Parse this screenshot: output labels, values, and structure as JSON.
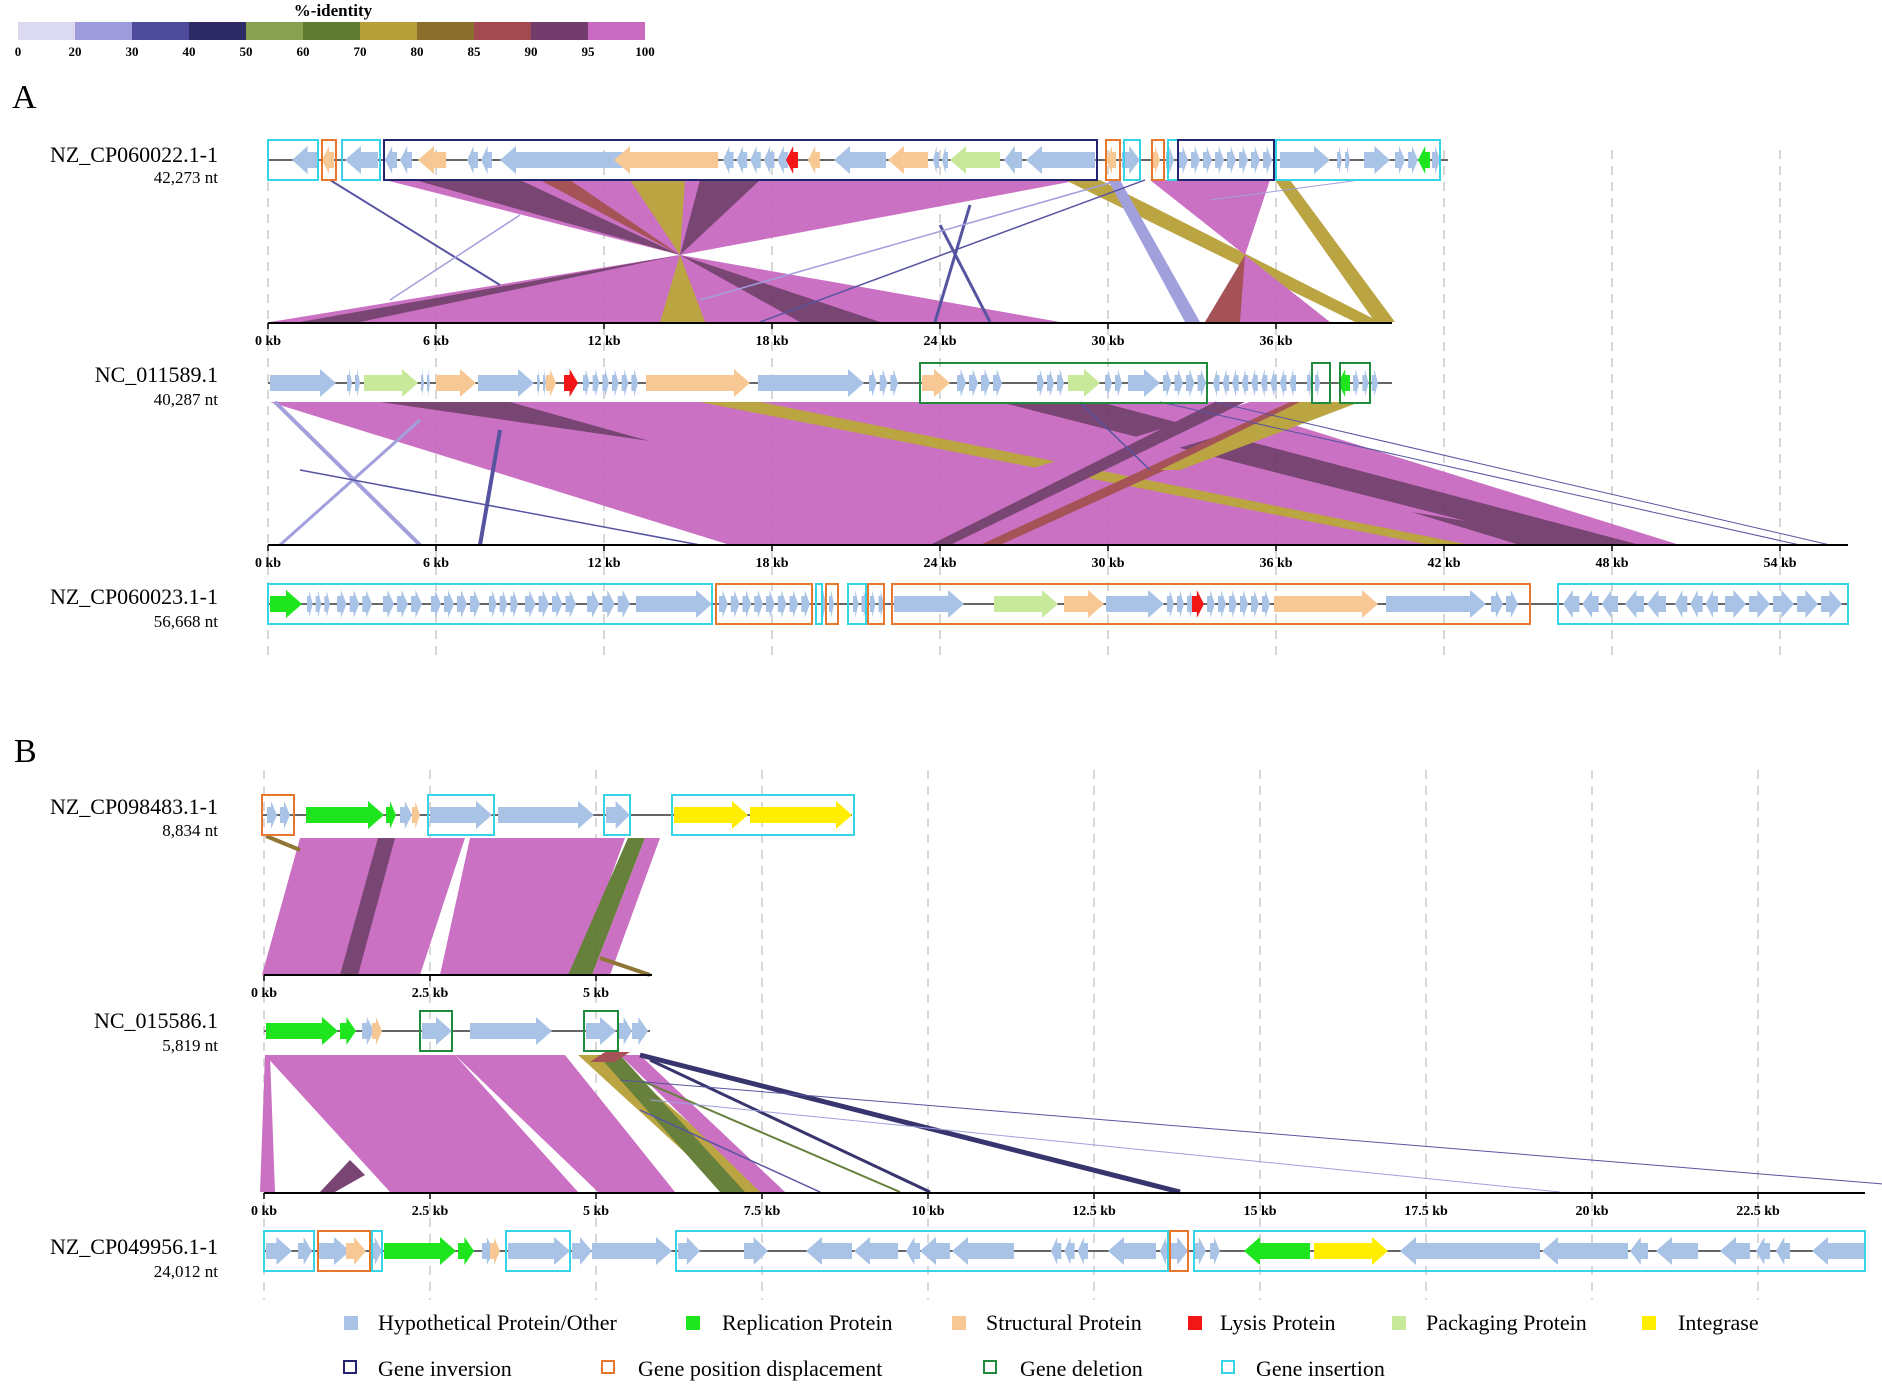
{
  "colorbar": {
    "title": "%-identity",
    "ticks": [
      "0",
      "20",
      "30",
      "40",
      "50",
      "60",
      "70",
      "80",
      "85",
      "90",
      "95",
      "100"
    ],
    "colors": [
      "#dcdaf0",
      "#9d9bdc",
      "#4e4b9c",
      "#2e2a66",
      "#88a050",
      "#5f7a32",
      "#b8a038",
      "#8a6e2c",
      "#a24a50",
      "#723c6c",
      "#c86ac0"
    ]
  },
  "panels": {
    "a": {
      "label": "A",
      "tracks": [
        {
          "name": "NZ_CP060022.1-1",
          "size": "42,273 nt"
        },
        {
          "name": "NC_011589.1",
          "size": "40,287 nt"
        },
        {
          "name": "NZ_CP060023.1-1",
          "size": "56,668 nt"
        }
      ],
      "scale1": [
        "0 kb",
        "6 kb",
        "12 kb",
        "18 kb",
        "24 kb",
        "30 kb",
        "36 kb"
      ],
      "scale2": [
        "0 kb",
        "6 kb",
        "12 kb",
        "18 kb",
        "24 kb",
        "30 kb",
        "36 kb",
        "42 kb",
        "48 kb",
        "54 kb"
      ]
    },
    "b": {
      "label": "B",
      "tracks": [
        {
          "name": "NZ_CP098483.1-1",
          "size": "8,834 nt"
        },
        {
          "name": "NC_015586.1",
          "size": "5,819 nt"
        },
        {
          "name": "NZ_CP049956.1-1",
          "size": "24,012 nt"
        }
      ],
      "scale1": [
        "0 kb",
        "2.5 kb",
        "5 kb"
      ],
      "scale2": [
        "0 kb",
        "2.5 kb",
        "5 kb",
        "7.5 kb",
        "10 kb",
        "12.5 kb",
        "15 kb",
        "17.5 kb",
        "20 kb",
        "22.5 kb"
      ]
    }
  },
  "legend": {
    "genes": [
      {
        "label": "Hypothetical Protein/Other",
        "color": "#a9c3e6"
      },
      {
        "label": "Replication Protein",
        "color": "#1fe51f"
      },
      {
        "label": "Structural Protein",
        "color": "#f8c894"
      },
      {
        "label": "Lysis Protein",
        "color": "#f21616"
      },
      {
        "label": "Packaging Protein",
        "color": "#c8e89a"
      },
      {
        "label": "Integrase",
        "color": "#ffee00"
      }
    ],
    "events": [
      {
        "label": "Gene inversion",
        "color": "#23236e"
      },
      {
        "label": "Gene position displacement",
        "color": "#e8772e"
      },
      {
        "label": "Gene deletion",
        "color": "#1f8a3c"
      },
      {
        "label": "Gene insertion",
        "color": "#36d4e6"
      }
    ]
  }
}
